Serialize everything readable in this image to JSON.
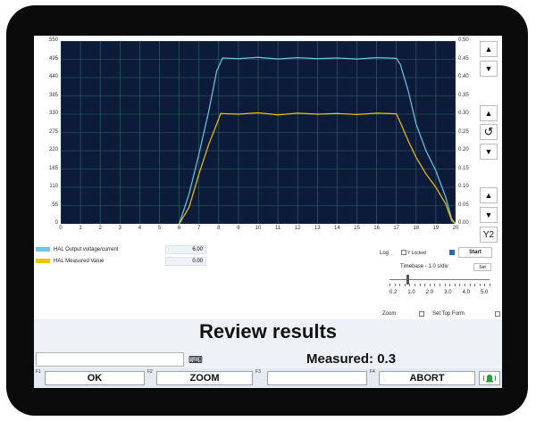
{
  "chart_data": {
    "type": "line",
    "xlim": [
      0,
      20
    ],
    "ylim_left": [
      0,
      550
    ],
    "ylim_right": [
      0,
      0.5
    ],
    "x_ticks": [
      "0",
      "1",
      "2",
      "3",
      "4",
      "5",
      "6",
      "7",
      "8",
      "9",
      "10",
      "11",
      "12",
      "13",
      "14",
      "15",
      "16",
      "17",
      "18",
      "19",
      "20"
    ],
    "y_ticks_left": [
      "550",
      "495",
      "440",
      "385",
      "330",
      "275",
      "220",
      "165",
      "110",
      "55",
      "0"
    ],
    "y_ticks_right": [
      "0.50",
      "0.45",
      "0.40",
      "0.35",
      "0.30",
      "0.25",
      "0.20",
      "0.15",
      "0.10",
      "0.05",
      "0.00"
    ],
    "grid": true,
    "series": [
      {
        "name": "HAL Output voltage/current",
        "color": "#6ec6e6",
        "x": [
          6.0,
          6.5,
          7.0,
          7.5,
          7.9,
          8.2,
          9.0,
          10.0,
          11.0,
          12.0,
          13.0,
          14.0,
          15.0,
          16.0,
          17.0,
          17.2,
          17.6,
          18.0,
          18.5,
          19.0,
          19.5,
          19.8,
          20.0
        ],
        "y": [
          0,
          90,
          210,
          340,
          460,
          499,
          497,
          501,
          496,
          500,
          497,
          499,
          496,
          500,
          498,
          480,
          400,
          300,
          220,
          160,
          80,
          15,
          0
        ]
      },
      {
        "name": "HAL Measured Value",
        "color": "#f2c200",
        "x": [
          6.0,
          6.5,
          7.0,
          7.5,
          7.9,
          8.1,
          9.0,
          10.0,
          11.0,
          12.0,
          13.0,
          14.0,
          15.0,
          16.0,
          17.0,
          17.2,
          17.6,
          18.0,
          18.5,
          19.0,
          19.5,
          19.8,
          20.0
        ],
        "y": [
          0,
          50,
          150,
          240,
          300,
          332,
          330,
          334,
          328,
          333,
          330,
          332,
          329,
          333,
          331,
          305,
          250,
          200,
          150,
          110,
          60,
          10,
          0
        ]
      }
    ]
  },
  "legend": {
    "items": [
      {
        "label": "HAL Output voltage/current",
        "value": "6.00",
        "color": "#6ec6e6"
      },
      {
        "label": "HAL Measured Value",
        "value": "0.00",
        "color": "#f2c200"
      }
    ]
  },
  "controls": {
    "log_label": "Log",
    "y_locked_label": "Y Locked",
    "start_label": "Start",
    "timebase_label": "Timebase - 1.0 s/div",
    "set_label": "Set",
    "slider_labels": [
      "0.2",
      "1.0",
      "2.0",
      "3.0",
      "4.0",
      "5.0"
    ],
    "slider_level_fraction": 0.18,
    "zoom_label": "Zoom",
    "set_top_form_label": "Set Top Form",
    "y2_label": "Y2"
  },
  "status": {
    "title": "Review results",
    "measured": "Measured: 0.3",
    "input_value": ""
  },
  "function_bar": {
    "keys": [
      {
        "key_label": "F1",
        "label": "OK"
      },
      {
        "key_label": "F2",
        "label": "ZOOM"
      },
      {
        "key_label": "F3",
        "label": ""
      },
      {
        "key_label": "F4",
        "label": "ABORT"
      }
    ],
    "accent_color": "#2e9b3a"
  },
  "icons": {
    "side_buttons": [
      "triangle-up-icon",
      "triangle-down-icon",
      "refresh-icon"
    ],
    "input_icon": "keyboard-icon",
    "status_icon": "alarm-bell-icon"
  }
}
